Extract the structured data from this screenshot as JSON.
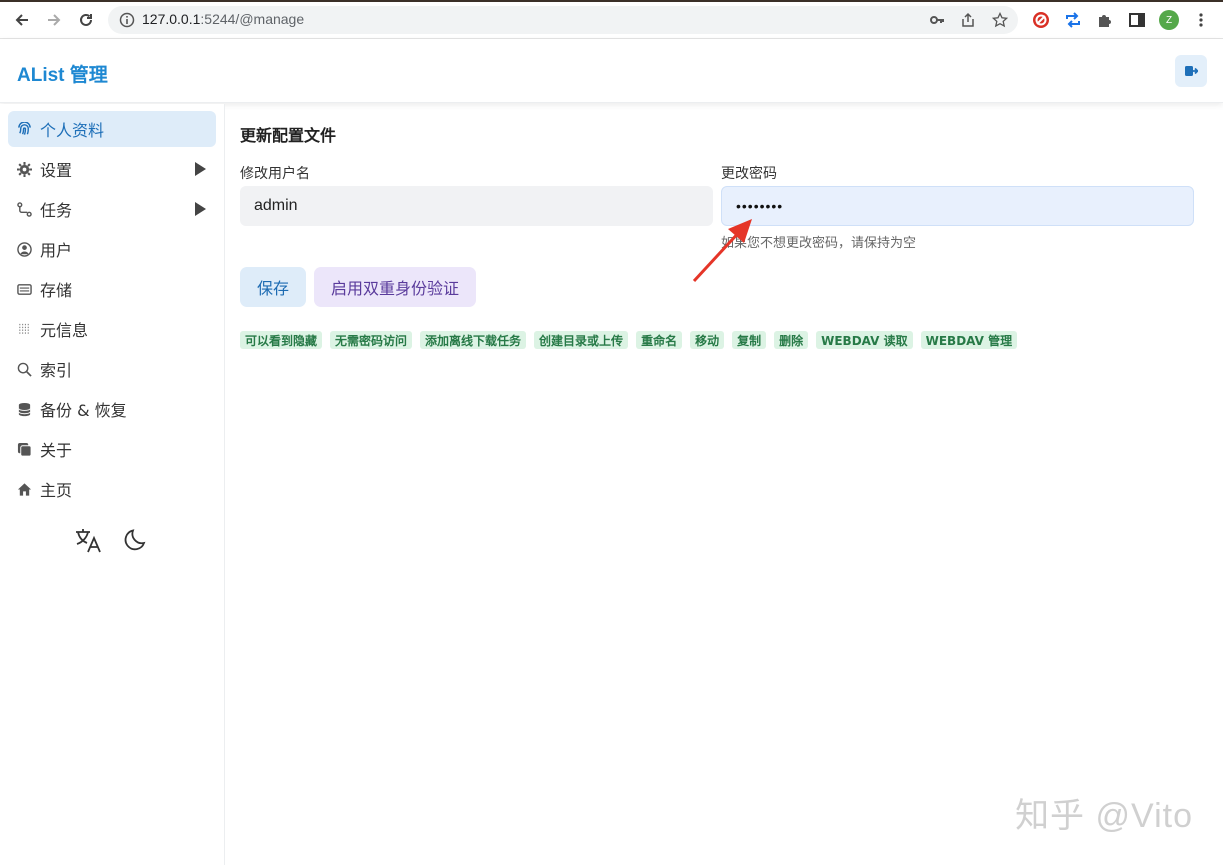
{
  "browser": {
    "url_host": "127.0.0.1",
    "url_rest": ":5244/@manage",
    "avatar_letter": "Z"
  },
  "app": {
    "title": "AList 管理"
  },
  "sidebar": {
    "items": [
      {
        "label": "个人资料",
        "icon": "fingerprint-icon"
      },
      {
        "label": "设置",
        "icon": "gear-icon"
      },
      {
        "label": "任务",
        "icon": "flow-icon"
      },
      {
        "label": "用户",
        "icon": "user-circle-icon"
      },
      {
        "label": "存储",
        "icon": "storage-icon"
      },
      {
        "label": "元信息",
        "icon": "metadata-icon"
      },
      {
        "label": "索引",
        "icon": "search-icon"
      },
      {
        "label": "备份 & 恢复",
        "icon": "database-icon"
      },
      {
        "label": "关于",
        "icon": "about-icon"
      },
      {
        "label": "主页",
        "icon": "home-icon"
      }
    ]
  },
  "main": {
    "section_title": "更新配置文件",
    "username_label": "修改用户名",
    "username_value": "admin",
    "password_label": "更改密码",
    "password_value": "••••••••",
    "password_hint": "如果您不想更改密码，请保持为空",
    "save_label": "保存",
    "enable_2fa_label": "启用双重身份验证",
    "permissions": [
      "可以看到隐藏",
      "无需密码访问",
      "添加离线下载任务",
      "创建目录或上传",
      "重命名",
      "移动",
      "复制",
      "删除",
      "WEBDAV 读取",
      "WEBDAV 管理"
    ]
  },
  "watermark": "知乎 @Vito",
  "colors": {
    "accent": "#1e88d2",
    "tag_bg": "#dcf3e4",
    "tag_text": "#277a47",
    "annotation_arrow": "#e53528"
  }
}
